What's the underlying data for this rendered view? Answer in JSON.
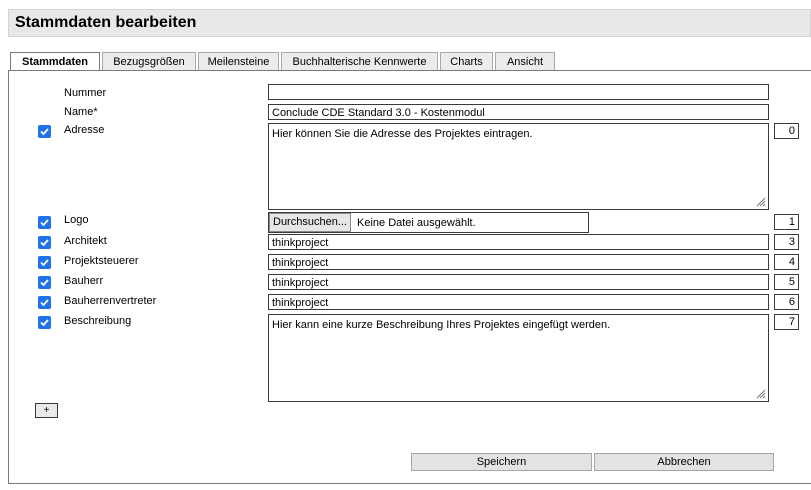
{
  "header": {
    "title": "Stammdaten bearbeiten"
  },
  "tabs": [
    {
      "label": "Stammdaten",
      "active": true
    },
    {
      "label": "Bezugsgrößen",
      "active": false
    },
    {
      "label": "Meilensteine",
      "active": false
    },
    {
      "label": "Buchhalterische Kennwerte",
      "active": false
    },
    {
      "label": "Charts",
      "active": false
    },
    {
      "label": "Ansicht",
      "active": false
    }
  ],
  "fields": {
    "nummer": {
      "label": "Nummer",
      "value": ""
    },
    "name": {
      "label": "Name*",
      "value": "Conclude CDE Standard 3.0 - Kostenmodul"
    },
    "adresse": {
      "label": "Adresse",
      "checked": true,
      "value": "Hier können Sie die Adresse des Projektes eintragen.",
      "order": "0"
    },
    "logo": {
      "label": "Logo",
      "checked": true,
      "browse_label": "Durchsuchen...",
      "file_status": "Keine Datei ausgewählt.",
      "order": "1"
    },
    "architekt": {
      "label": "Architekt",
      "checked": true,
      "value": "thinkproject",
      "order": "3"
    },
    "projektsteuerer": {
      "label": "Projektsteuerer",
      "checked": true,
      "value": "thinkproject",
      "order": "4"
    },
    "bauherr": {
      "label": "Bauherr",
      "checked": true,
      "value": "thinkproject",
      "order": "5"
    },
    "bauherrenvertreter": {
      "label": "Bauherrenvertreter",
      "checked": true,
      "value": "thinkproject",
      "order": "6"
    },
    "beschreibung": {
      "label": "Beschreibung",
      "checked": true,
      "value": "Hier kann eine kurze Beschreibung Ihres Projektes eingefügt werden.",
      "order": "7"
    }
  },
  "add_button": {
    "label": "+"
  },
  "actions": {
    "save_label": "Speichern",
    "cancel_label": "Abbrechen"
  },
  "colors": {
    "checkbox": "#1e73e8",
    "titlebar": "#e8e8e8"
  }
}
